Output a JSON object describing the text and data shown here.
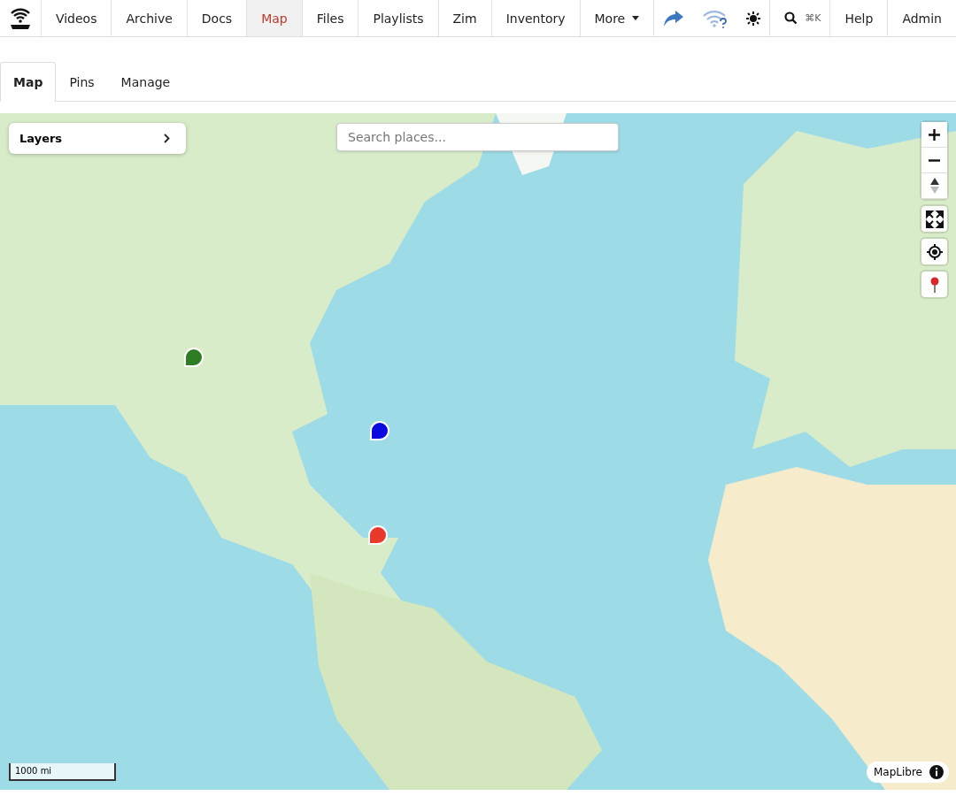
{
  "nav": {
    "items": [
      {
        "label": "Videos",
        "selected": false
      },
      {
        "label": "Archive",
        "selected": false
      },
      {
        "label": "Docs",
        "selected": false
      },
      {
        "label": "Map",
        "selected": true
      },
      {
        "label": "Files",
        "selected": false
      },
      {
        "label": "Playlists",
        "selected": false
      },
      {
        "label": "Zim",
        "selected": false
      },
      {
        "label": "Inventory",
        "selected": false
      }
    ],
    "more": "More",
    "search_shortcut": "⌘K",
    "help": "Help",
    "admin": "Admin"
  },
  "tabs": [
    {
      "label": "Map",
      "selected": true
    },
    {
      "label": "Pins",
      "selected": false
    },
    {
      "label": "Manage",
      "selected": false
    }
  ],
  "map": {
    "layers_label": "Layers",
    "search": {
      "placeholder": "Search places..."
    },
    "pins": [
      {
        "color": "#2e7d22"
      },
      {
        "color": "#0a0ae0"
      },
      {
        "color": "#e8392a"
      }
    ],
    "scale": "1000 mi",
    "attribution": "MapLibre"
  }
}
